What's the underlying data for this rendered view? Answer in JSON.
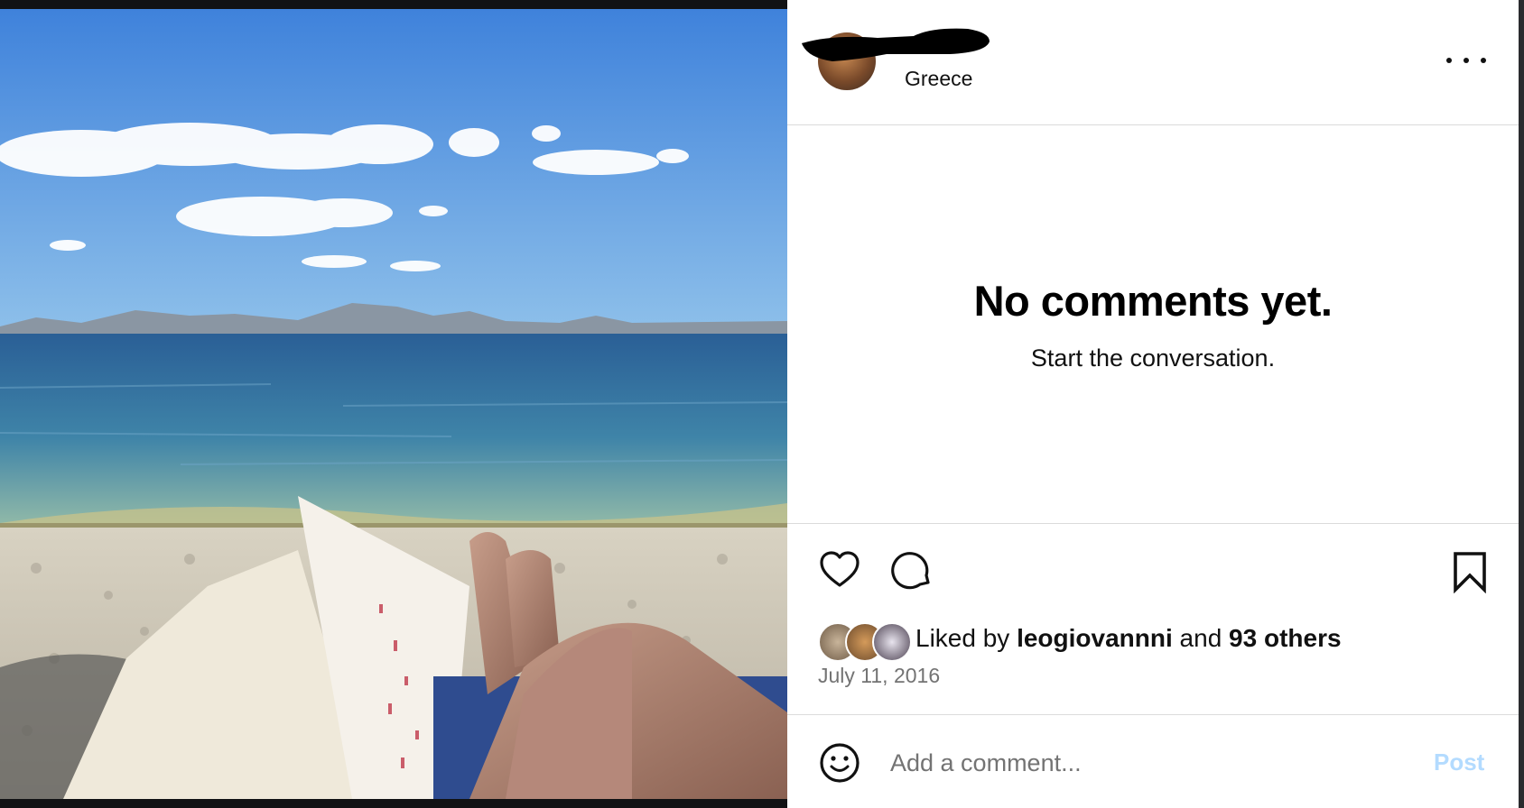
{
  "post": {
    "location": "Greece",
    "photo_alt": "beach photo",
    "empty_state": {
      "title": "No comments yet.",
      "subtitle": "Start the conversation."
    },
    "likes": {
      "prefix": "Liked by ",
      "user": "leogiovannni",
      "middle": " and ",
      "others": "93 others"
    },
    "date": "July 11, 2016"
  },
  "composer": {
    "placeholder": "Add a comment...",
    "post_label": "Post"
  },
  "icons": {
    "more": "more-options-icon",
    "like": "heart-icon",
    "comment": "comment-bubble-icon",
    "save": "bookmark-icon",
    "emoji": "smiley-face-icon"
  },
  "colors": {
    "post_button_disabled": "#b3dbff",
    "secondary_text": "#737373",
    "divider": "#dbdbdb"
  }
}
